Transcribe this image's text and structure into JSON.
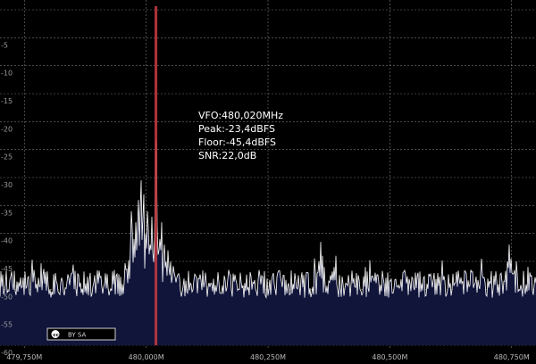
{
  "readout": {
    "vfo": "VFO:480,020MHz",
    "peak": "Peak:-23,4dBFS",
    "floor": "Floor:-45,4dBFS",
    "snr": "SNR:22,0dB"
  },
  "license_badge": {
    "icon": "creative-commons-icon",
    "text": "BY  SA"
  },
  "colors": {
    "background": "#000000",
    "grid": "#7a7a7a",
    "trace": "#ffffff",
    "fill": "#11153a",
    "vfo_marker": "#c0393f"
  },
  "chart_data": {
    "type": "line",
    "y_axis": {
      "range": [
        -60,
        0
      ],
      "ticks": [
        "",
        "-5",
        "-10",
        "-15",
        "-20",
        "-25",
        "-30",
        "-35",
        "-40",
        "-45",
        "-50",
        "-55",
        "-60"
      ],
      "tick_values": [
        0,
        -5,
        -10,
        -15,
        -20,
        -25,
        -30,
        -35,
        -40,
        -45,
        -50,
        -55,
        -60
      ]
    },
    "x_axis": {
      "range": [
        479.7,
        480.8
      ],
      "ticks": [
        "479,750M",
        "480,000M",
        "480,250M",
        "480,500M",
        "480,750M"
      ],
      "tick_values": [
        479.75,
        480.0,
        480.25,
        480.5,
        480.75
      ]
    },
    "vfo_freq": 480.02,
    "grid": true,
    "noise_floor": -49,
    "peaks": [
      [
        479.969,
        -36
      ],
      [
        479.972,
        -39
      ],
      [
        479.975,
        -41
      ],
      [
        479.978,
        -38
      ],
      [
        479.981,
        -43
      ],
      [
        479.984,
        -34
      ],
      [
        479.987,
        -38
      ],
      [
        479.99,
        -30.5
      ],
      [
        479.993,
        -37
      ],
      [
        479.996,
        -33
      ],
      [
        479.999,
        -40
      ],
      [
        480.002,
        -36
      ],
      [
        480.005,
        -39
      ],
      [
        480.008,
        -42
      ],
      [
        480.011,
        -37
      ],
      [
        480.014,
        -44
      ],
      [
        480.017,
        -41
      ],
      [
        480.02,
        -23.4
      ],
      [
        480.023,
        -39
      ],
      [
        480.026,
        -43
      ],
      [
        480.029,
        -41
      ],
      [
        480.032,
        -38
      ],
      [
        480.035,
        -44
      ],
      [
        480.038,
        -42
      ],
      [
        480.041,
        -45
      ],
      [
        480.044,
        -43
      ],
      [
        480.047,
        -46
      ],
      [
        480.05,
        -45
      ],
      [
        480.058,
        -47
      ],
      [
        480.066,
        -48
      ],
      [
        480.358,
        -41.5
      ],
      [
        480.362,
        -44
      ],
      [
        480.366,
        -46
      ],
      [
        480.354,
        -45
      ],
      [
        480.385,
        -46
      ],
      [
        480.39,
        -44
      ],
      [
        480.745,
        -42
      ],
      [
        480.749,
        -44.5
      ],
      [
        480.741,
        -45
      ]
    ]
  }
}
